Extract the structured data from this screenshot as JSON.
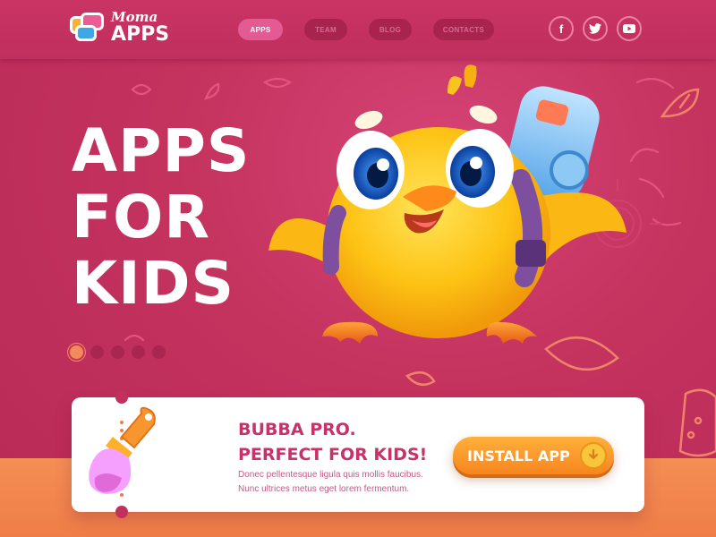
{
  "brand": {
    "line1": "Moma",
    "line2": "APPS"
  },
  "nav": [
    {
      "label": "APPS",
      "active": true
    },
    {
      "label": "TEAM",
      "active": false
    },
    {
      "label": "BLOG",
      "active": false
    },
    {
      "label": "CONTACTS",
      "active": false
    }
  ],
  "socials": [
    {
      "icon": "facebook-icon",
      "glyph": "f"
    },
    {
      "icon": "twitter-icon",
      "glyph": "🐦"
    },
    {
      "icon": "youtube-icon",
      "glyph": "▶"
    }
  ],
  "hero": {
    "line1": "APPS",
    "line2": "FOR",
    "line3": "KIDS"
  },
  "slider": {
    "count": 5,
    "active_index": 0
  },
  "promo": {
    "title_line1": "BUBBA PRO.",
    "title_line2": "PERFECT FOR KIDS!",
    "desc_line1": "Donec pellentesque ligula quis mollis faucibus.",
    "desc_line2": "Nunc ultrices metus eget lorem fermentum.",
    "button_label": "INSTALL APP"
  },
  "colors": {
    "background": "#c5335f",
    "accent_orange": "#f48e55",
    "nav_active": "#e45b93",
    "title_pink": "#c8316a"
  }
}
